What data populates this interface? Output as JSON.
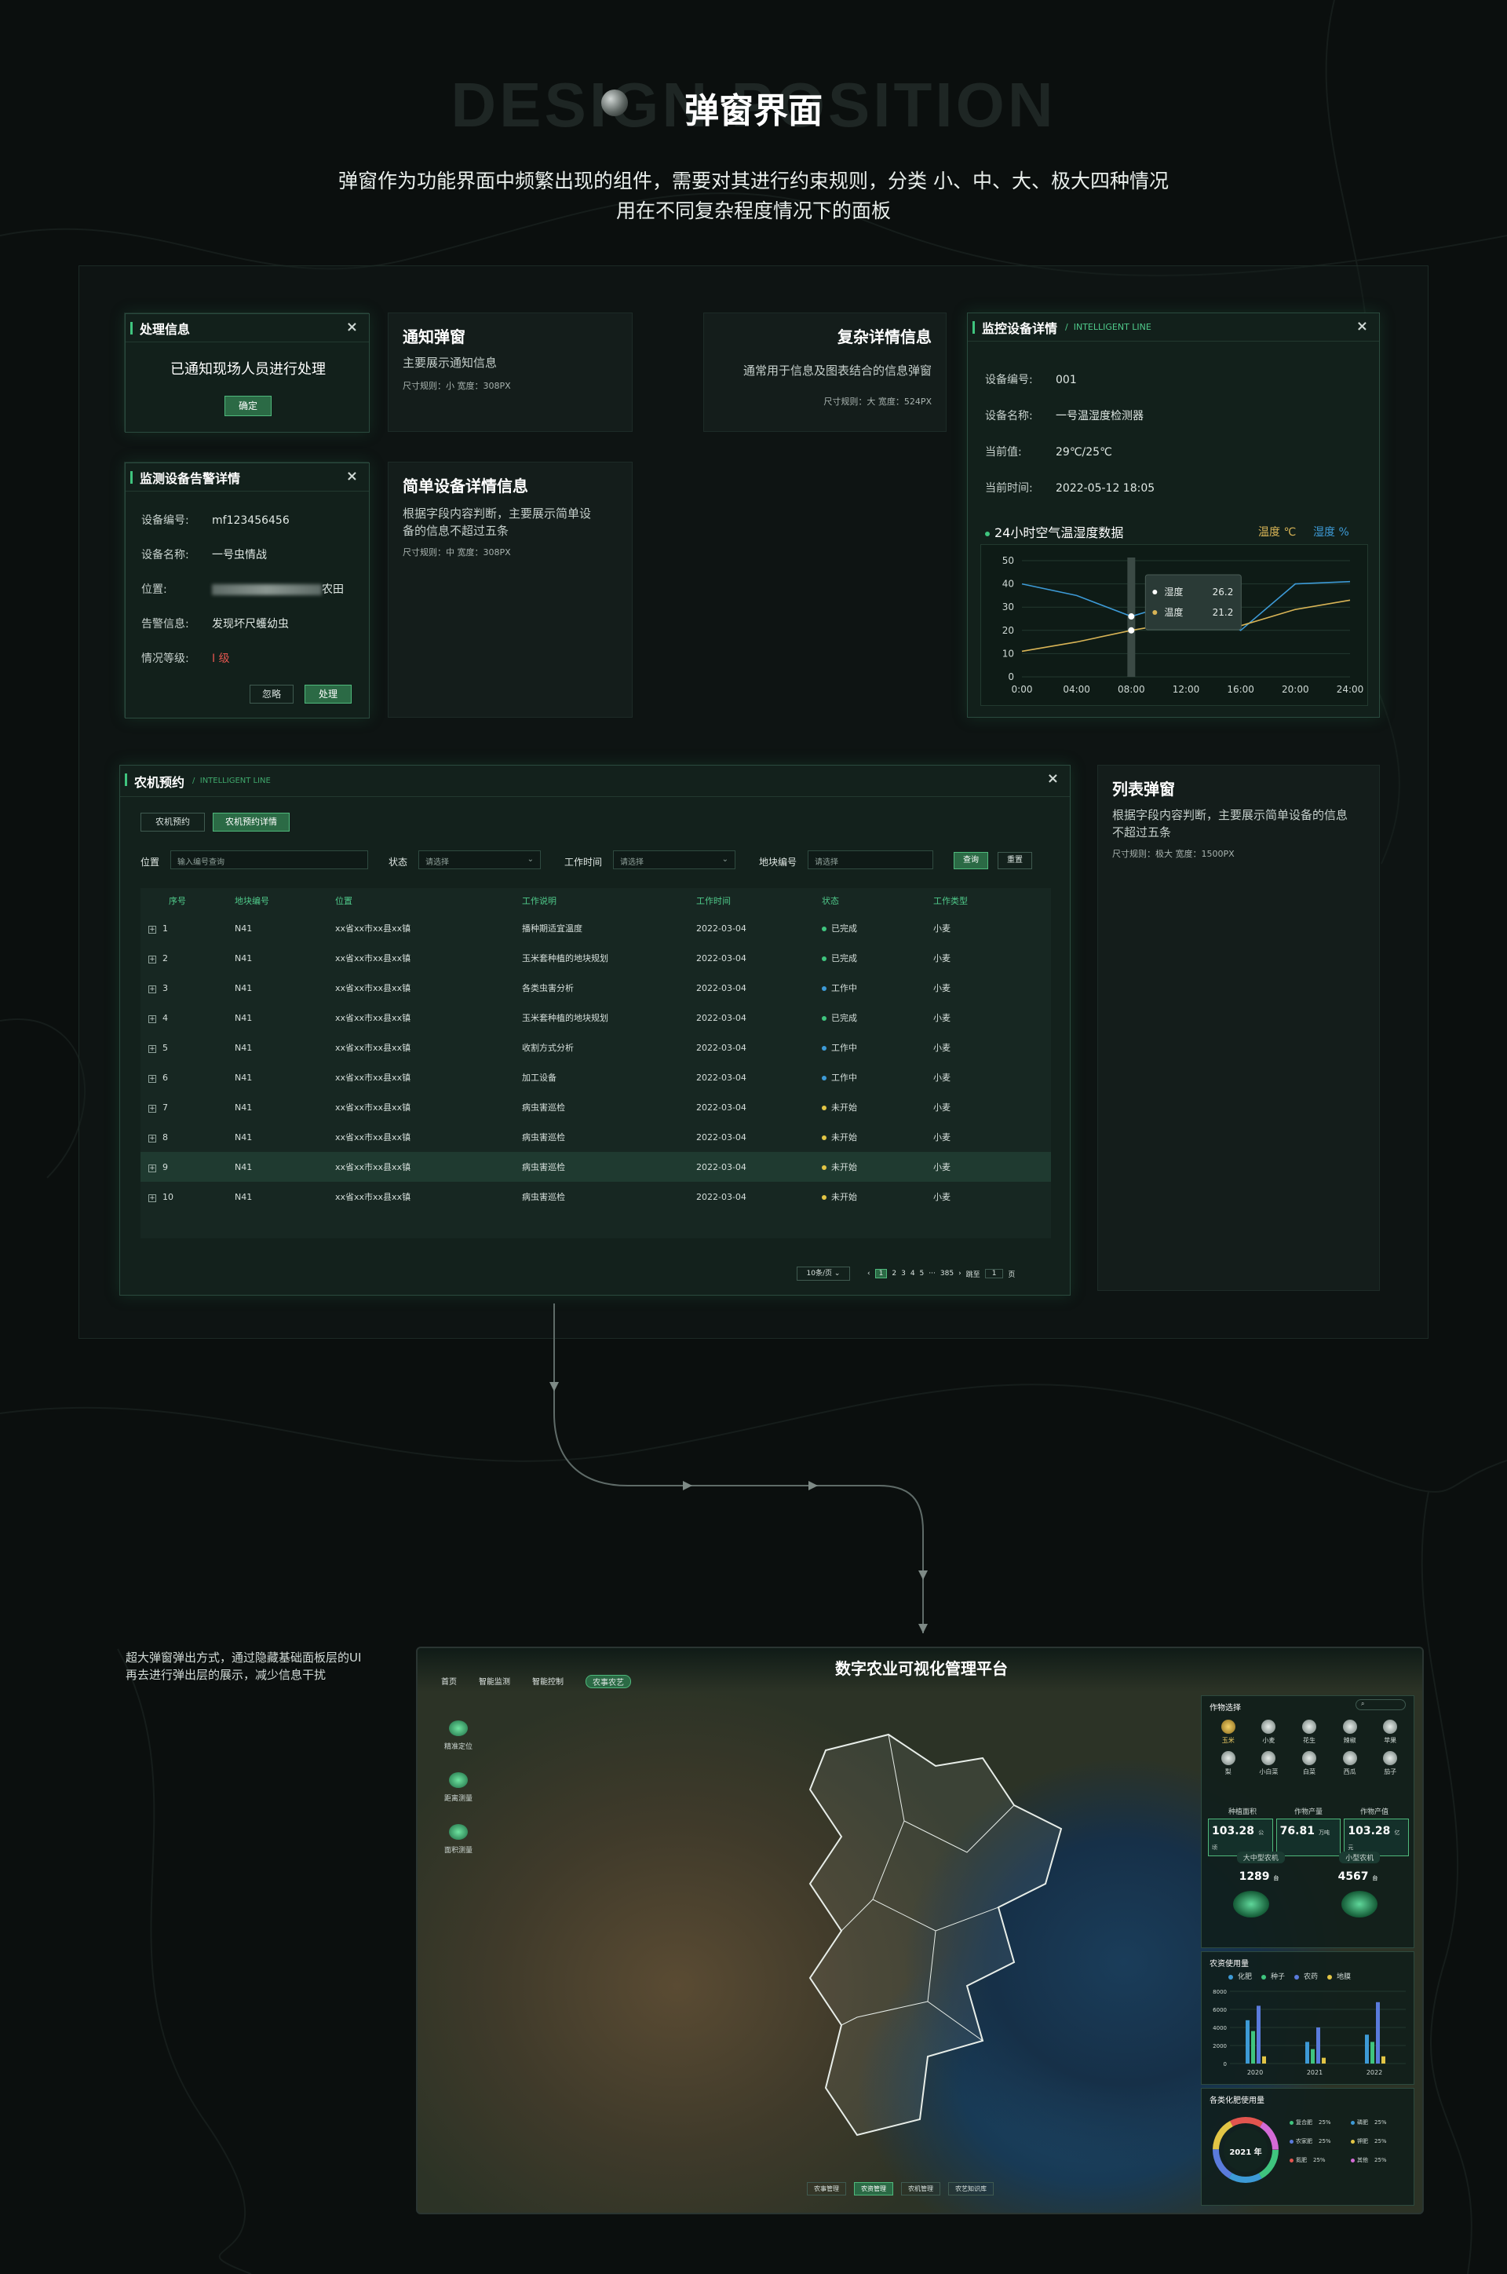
{
  "header": {
    "ghost_title": "DESIGN POSITION",
    "title": "弹窗界面",
    "intro_line1": "弹窗作为功能界面中频繁出现的组件，需要对其进行约束规则，分类 小、中、大、极大四种情况",
    "intro_line2": "用在不同复杂程度情况下的面板"
  },
  "dlg_process": {
    "title": "处理信息",
    "message": "已通知现场人员进行处理",
    "confirm": "确定"
  },
  "note_notify": {
    "title": "通知弹窗",
    "desc": "主要展示通知信息",
    "size": "尺寸规则：小 宽度：308PX"
  },
  "note_complex": {
    "title": "复杂详情信息",
    "desc": "通常用于信息及图表结合的信息弹窗",
    "size": "尺寸规则：大 宽度：524PX"
  },
  "dlg_alarm": {
    "title": "监测设备告警详情",
    "rows": [
      {
        "k": "设备编号:",
        "v": "mf123456456"
      },
      {
        "k": "设备名称:",
        "v": "一号虫情战"
      },
      {
        "k": "位置:",
        "v": "农田"
      },
      {
        "k": "告警信息:",
        "v": "发现坏尺蠖幼虫"
      },
      {
        "k": "情况等级:",
        "v": "I 级"
      }
    ],
    "ignore": "忽略",
    "handle": "处理"
  },
  "note_simple": {
    "title": "简单设备详情信息",
    "desc1": "根据字段内容判断，主要展示简单设",
    "desc2": "备的信息不超过五条",
    "size": "尺寸规则：中 宽度：308PX"
  },
  "dlg_monitor": {
    "title": "监控设备详情",
    "subtitle": "INTELLIGENT LINE",
    "rows": [
      {
        "k": "设备编号:",
        "v": "001"
      },
      {
        "k": "设备名称:",
        "v": "一号温湿度检测器"
      },
      {
        "k": "当前值:",
        "v": "29℃/25℃"
      },
      {
        "k": "当前时间:",
        "v": "2022-05-12 18:05"
      }
    ],
    "chart_title": "24小时空气温湿度数据",
    "legend_temp": "温度 ℃",
    "legend_hum": "湿度 %",
    "tooltip_temp_label": "湿度",
    "tooltip_temp_val": "26.2",
    "tooltip_hum_label": "温度",
    "tooltip_hum_val": "21.2"
  },
  "chart_data": {
    "type": "line",
    "title": "24小时空气温湿度数据",
    "x": [
      "0:00",
      "04:00",
      "08:00",
      "12:00",
      "16:00",
      "20:00",
      "24:00"
    ],
    "ylim": [
      0,
      50
    ],
    "yticks": [
      "50",
      "40",
      "30",
      "20",
      "10",
      "0"
    ],
    "series": [
      {
        "name": "湿度 %",
        "color": "#3d9ad6",
        "values": [
          40,
          35,
          26,
          33,
          20,
          40,
          41
        ]
      },
      {
        "name": "温度 ℃",
        "color": "#d8b456",
        "values": [
          11,
          15,
          20,
          24,
          22,
          29,
          33
        ]
      }
    ],
    "grid": true,
    "legend": "top-right"
  },
  "dlg_list": {
    "title": "农机预约",
    "subtitle": "INTELLIGENT LINE",
    "tabs": [
      "农机预约",
      "农机预约详情"
    ],
    "filter_location_label": "位置",
    "filter_location_ph": "输入编号查询",
    "filter_status_label": "状态",
    "filter_status_ph": "请选择",
    "filter_time_label": "工作时间",
    "filter_time_ph": "请选择",
    "filter_plot_label": "地块编号",
    "filter_plot_ph": "请选择",
    "query": "查询",
    "reset": "重置",
    "columns": [
      "序号",
      "地块编号",
      "位置",
      "工作说明",
      "工作时间",
      "状态",
      "工作类型"
    ],
    "rows": [
      [
        "1",
        "N41",
        "xx省xx市xx县xx镇",
        "播种期适宜温度",
        "2022-03-04",
        "已完成",
        "小麦",
        "#3fc47e"
      ],
      [
        "2",
        "N41",
        "xx省xx市xx县xx镇",
        "玉米套种植的地块规划",
        "2022-03-04",
        "已完成",
        "小麦",
        "#3fc47e"
      ],
      [
        "3",
        "N41",
        "xx省xx市xx县xx镇",
        "各类虫害分析",
        "2022-03-04",
        "工作中",
        "小麦",
        "#3d9ad6"
      ],
      [
        "4",
        "N41",
        "xx省xx市xx县xx镇",
        "玉米套种植的地块规划",
        "2022-03-04",
        "已完成",
        "小麦",
        "#3fc47e"
      ],
      [
        "5",
        "N41",
        "xx省xx市xx县xx镇",
        "收割方式分析",
        "2022-03-04",
        "工作中",
        "小麦",
        "#3d9ad6"
      ],
      [
        "6",
        "N41",
        "xx省xx市xx县xx镇",
        "加工设备",
        "2022-03-04",
        "工作中",
        "小麦",
        "#3d9ad6"
      ],
      [
        "7",
        "N41",
        "xx省xx市xx县xx镇",
        "病虫害巡检",
        "2022-03-04",
        "未开始",
        "小麦",
        "#e2c545"
      ],
      [
        "8",
        "N41",
        "xx省xx市xx县xx镇",
        "病虫害巡检",
        "2022-03-04",
        "未开始",
        "小麦",
        "#e2c545"
      ],
      [
        "9",
        "N41",
        "xx省xx市xx县xx镇",
        "病虫害巡检",
        "2022-03-04",
        "未开始",
        "小麦",
        "#e2c545"
      ],
      [
        "10",
        "N41",
        "xx省xx市xx县xx镇",
        "病虫害巡检",
        "2022-03-04",
        "未开始",
        "小麦",
        "#e2c545"
      ]
    ],
    "page_size": "10条/页",
    "pages": [
      "1",
      "2",
      "3",
      "4",
      "5",
      "···",
      "385"
    ],
    "goto": "跳至",
    "goto_val": "1",
    "page_unit": "页"
  },
  "note_list": {
    "title": "列表弹窗",
    "desc1": "根据字段内容判断，主要展示简单设备的信息",
    "desc2": "不超过五条",
    "size": "尺寸规则：极大 宽度：1500PX"
  },
  "note_dash": {
    "line1": "超大弹窗弹出方式，通过隐藏基础面板层的UI",
    "line2": "再去进行弹出层的展示，减少信息干扰"
  },
  "dashboard": {
    "title": "数字农业可视化管理平台",
    "nav": [
      "首页",
      "智能监测",
      "智能控制",
      "农事农艺"
    ],
    "left_tools": [
      "精准定位",
      "距离测量",
      "面积测量"
    ],
    "crop_title": "作物选择",
    "crops": [
      "玉米",
      "小麦",
      "花生",
      "辣椒",
      "苹果",
      "梨",
      "小白菜",
      "白菜",
      "西瓜",
      "茄子"
    ],
    "stat_labels": [
      "种植面积",
      "作物产量",
      "作物产值"
    ],
    "stat_values": [
      "103.28",
      "76.81",
      "103.28"
    ],
    "stat_units": [
      "公顷",
      "万吨",
      "亿元"
    ],
    "machine_labels": [
      "大中型农机",
      "小型农机"
    ],
    "machine_values": [
      "1289",
      "4567"
    ],
    "machine_unit": "台",
    "pesticide_title": "农资使用量",
    "pesticide_legend": [
      "化肥",
      "种子",
      "农药",
      "地膜"
    ],
    "bar_years": [
      "2020",
      "2021",
      "2022"
    ],
    "bar_yticks": [
      "8000",
      "6000",
      "4000",
      "2000",
      "0"
    ],
    "fert_title": "各类化肥使用量",
    "donut_label": "2021 年",
    "fert_items": [
      {
        "name": "复合肥",
        "pct": "25%",
        "color": "#3fc47e"
      },
      {
        "name": "磷肥",
        "pct": "25%",
        "color": "#3d9ad6"
      },
      {
        "name": "农家肥",
        "pct": "25%",
        "color": "#5a7bdc"
      },
      {
        "name": "钾肥",
        "pct": "25%",
        "color": "#e2c545"
      },
      {
        "name": "氮肥",
        "pct": "25%",
        "color": "#e2554f"
      },
      {
        "name": "其他",
        "pct": "25%",
        "color": "#d46ad6"
      }
    ],
    "bottom_tabs": [
      "农事管理",
      "农资管理",
      "农机管理",
      "农艺知识库"
    ]
  }
}
